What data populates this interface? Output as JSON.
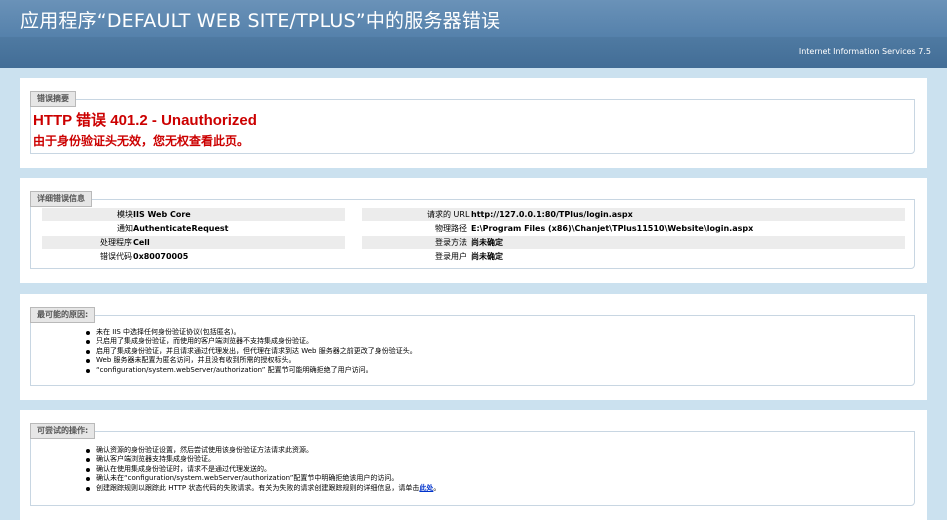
{
  "header": {
    "title": "应用程序“DEFAULT WEB SITE/TPLUS”中的服务器错误",
    "server": "Internet Information Services 7.5"
  },
  "summary": {
    "legend": "错误摘要",
    "error_title": "HTTP 错误 401.2 - Unauthorized",
    "error_message": "由于身份验证头无效，您无权查看此页。"
  },
  "details": {
    "legend": "详细错误信息",
    "module_label": "模块",
    "module_value": "IIS Web Core",
    "notification_label": "通知",
    "notification_value": "AuthenticateRequest",
    "handler_label": "处理程序",
    "handler_value": "Cell",
    "error_code_label": "错误代码",
    "error_code_value": "0x80070005",
    "url_label": "请求的 URL",
    "url_value": "http://127.0.0.1:80/TPlus/login.aspx",
    "physical_path_label": "物理路径",
    "physical_path_value": "E:\\Program Files (x86)\\Chanjet\\TPlus11510\\Website\\login.aspx",
    "logon_method_label": "登录方法",
    "logon_method_value": "尚未确定",
    "logon_user_label": "登录用户",
    "logon_user_value": "尚未确定"
  },
  "causes": {
    "legend": "最可能的原因:",
    "items": [
      "未在 IIS 中选择任何身份验证协议(包括匿名)。",
      "只启用了集成身份验证，而使用的客户端浏览器不支持集成身份验证。",
      "启用了集成身份验证，并且请求通过代理发出，但代理在请求到达 Web 服务器之前更改了身份验证头。",
      "Web 服务器未配置为匿名访问，并且没有收到所需的授权标头。",
      "“configuration/system.webServer/authorization” 配置节可能明确拒绝了用户访问。"
    ]
  },
  "actions": {
    "legend": "可尝试的操作:",
    "items": [
      "确认资源的身份验证设置，然后尝试使用该身份验证方法请求此资源。",
      "确认客户端浏览器支持集成身份验证。",
      "确认在使用集成身份验证时，请求不是通过代理发送的。",
      "确认未在“configuration/system.webServer/authorization”配置节中明确拒绝该用户的访问。"
    ],
    "last_item_text": "创建跟踪规则以跟踪此 HTTP 状态代码的失败请求。有关为失败的请求创建跟踪规则的详细信息，请单击",
    "last_item_link": "此处",
    "last_item_end": "。"
  }
}
